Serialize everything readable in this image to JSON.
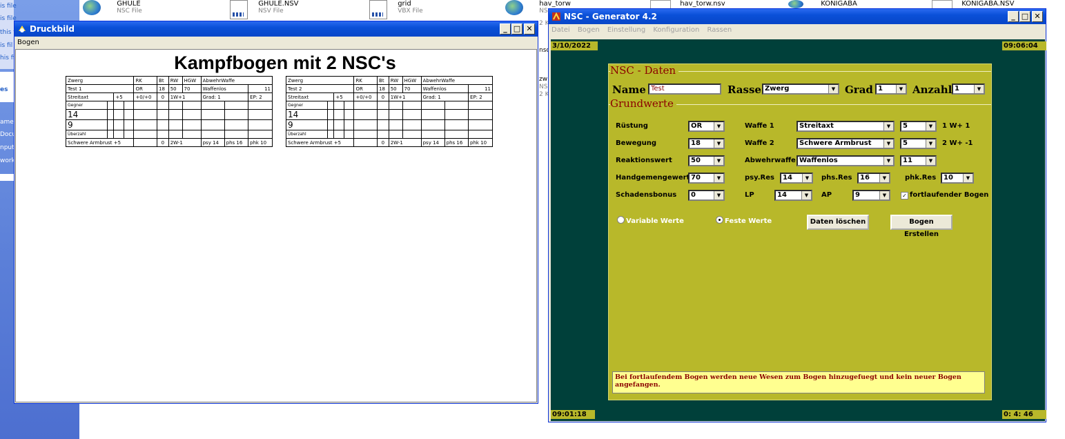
{
  "explorer": {
    "left_items": [
      "is file",
      "is file",
      "this f",
      "is fil",
      "his fi",
      "es",
      "amer",
      "Docu",
      "npute",
      "work"
    ],
    "files": [
      {
        "name": "GHULE",
        "sub": "NSC File"
      },
      {
        "name": "GHULE.NSV",
        "sub": "NSV File"
      },
      {
        "name": "grid",
        "sub": "VBX File"
      },
      {
        "name": "hav_torw",
        "sub": "NS"
      },
      {
        "name": "hav_torw.nsv",
        "sub": ""
      },
      {
        "name": "KONIGABA",
        "sub": ""
      },
      {
        "name": "KONIGABA.NSV",
        "sub": ""
      }
    ],
    "behind": [
      "2 K",
      "nsc",
      "zw",
      "NS",
      "2 K"
    ]
  },
  "druckbild": {
    "title": "Druckbild",
    "menu": [
      "Bogen"
    ],
    "sheet_title": "Kampfbogen mit 2 NSC's",
    "cards": [
      {
        "race": "Zwerg",
        "h_rk": "RK",
        "h_bt": "Bt",
        "h_rw": "RW",
        "h_hgw": "HGW",
        "h_abw": "AbwehrWaffe",
        "name": "Test 1",
        "rk": "OR",
        "bt": "18",
        "rw": "50",
        "hgw": "70",
        "abw": "Waffenlos",
        "abwv": "11",
        "w1": "Streitaxt",
        "w1b": "+5",
        "w1c": "+0/+0",
        "w1d": "0",
        "w1e": "1W+1",
        "grad": "Grad: 1",
        "ep": "EP:  2",
        "gegner": "Gegner",
        "n14": "14",
        "n9": "9",
        "ueber": "Überzahl",
        "w2": "Schwere Armbrust  +5",
        "w2d": "0",
        "w2e": "2W-1",
        "psy": "psy 14",
        "phs": "phs 16",
        "phk": "phk 10"
      },
      {
        "race": "Zwerg",
        "h_rk": "RK",
        "h_bt": "Bt",
        "h_rw": "RW",
        "h_hgw": "HGW",
        "h_abw": "AbwehrWaffe",
        "name": "Test 2",
        "rk": "OR",
        "bt": "18",
        "rw": "50",
        "hgw": "70",
        "abw": "Waffenlos",
        "abwv": "11",
        "w1": "Streitaxt",
        "w1b": "+5",
        "w1c": "+0/+0",
        "w1d": "0",
        "w1e": "1W+1",
        "grad": "Grad: 1",
        "ep": "EP:  2",
        "gegner": "Gegner",
        "n14": "14",
        "n9": "9",
        "ueber": "Überzahl",
        "w2": "Schwere Armbrust  +5",
        "w2d": "0",
        "w2e": "2W-1",
        "psy": "psy 14",
        "phs": "phs 16",
        "phk": "phk 10"
      }
    ]
  },
  "nsc": {
    "title": "NSC - Generator 4.2",
    "menu": [
      "Datei",
      "Bogen",
      "Einstellung",
      "Konfiguration",
      "Rassen"
    ],
    "date": "3/10/2022",
    "time_top": "09:06:04",
    "time_bottom_left": "09:01:18",
    "time_bottom_right": "0: 4: 46",
    "group1": "NSC - Daten",
    "name_label": "Name",
    "name_value": "Test",
    "rasse_label": "Rasse",
    "rasse_value": "Zwerg",
    "grad_label": "Grad",
    "grad_value": "1",
    "anzahl_label": "Anzahl",
    "anzahl_value": "1",
    "group2": "Grundwerte",
    "ruestung_label": "Rüstung",
    "ruestung_value": "OR",
    "bewegung_label": "Bewegung",
    "bewegung_value": "18",
    "reaktion_label": "Reaktionswert",
    "reaktion_value": "50",
    "hgw_label": "Handgemengewert",
    "hgw_value": "70",
    "schaden_label": "Schadensbonus",
    "schaden_value": "0",
    "waffe1_label": "Waffe 1",
    "waffe1_value": "Streitaxt",
    "waffe1_bonus": "5",
    "waffe1_dmg": "1  W+ 1",
    "waffe2_label": "Waffe 2",
    "waffe2_value": "Schwere Armbrust",
    "waffe2_bonus": "5",
    "waffe2_dmg": "2  W+ -1",
    "abwehr_label": "Abwehrwaffe",
    "abwehr_value": "Waffenlos",
    "abwehr_bonus": "11",
    "psy_label": "psy.Res",
    "psy_value": "14",
    "phs_label": "phs.Res",
    "phs_value": "16",
    "phk_label": "phk.Res",
    "phk_value": "10",
    "lp_label": "LP",
    "lp_value": "14",
    "ap_label": "AP",
    "ap_value": "9",
    "fortlaufend_label": "fortlaufender Bogen",
    "variable_label": "Variable Werte",
    "feste_label": "Feste Werte",
    "loeschen_label": "Daten löschen",
    "erstellen_label": "Bogen Erstellen",
    "info": "Bei fortlaufendem Bogen werden neue Wesen zum Bogen hinzugefuegt und kein neuer Bogen angefangen."
  }
}
